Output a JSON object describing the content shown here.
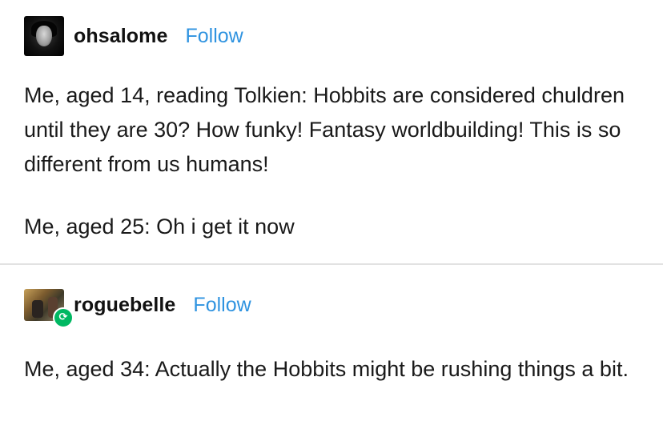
{
  "posts": [
    {
      "username": "ohsalome",
      "follow_label": "Follow",
      "paragraphs": [
        "Me, aged 14, reading Tolkien: Hobbits are considered chuldren until they are 30? How funky! Fantasy worldbuilding! This is so different from us humans!",
        "Me, aged 25: Oh i get it now"
      ]
    },
    {
      "username": "roguebelle",
      "follow_label": "Follow",
      "reblog_icon": "reblog-icon",
      "paragraphs": [
        "Me, aged 34: Actually the Hobbits might be rushing things a bit."
      ]
    }
  ],
  "colors": {
    "follow": "#2f93e0",
    "reblog_badge": "#00b862",
    "divider": "#e2e2e2"
  }
}
